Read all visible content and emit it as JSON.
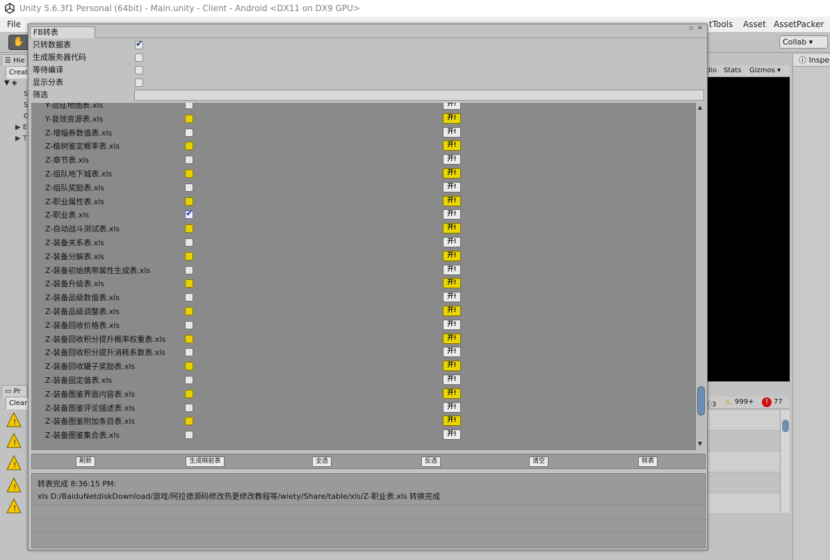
{
  "titlebar": {
    "title": "Unity 5.6.3f1 Personal (64bit) - Main.unity - Client - Android <DX11 on DX9 GPU>"
  },
  "menubar": {
    "items": [
      "File",
      "tTools",
      "Asset",
      "AssetPacker"
    ]
  },
  "toolbar": {
    "collab_label": "Collab ▾"
  },
  "hierarchy": {
    "tab": "☰ Hie",
    "create": "Creat",
    "rows": [
      "S",
      "S",
      "G",
      "E",
      "T"
    ]
  },
  "gameview": {
    "tabs": [
      "dio",
      "Stats",
      "Gizmos ▾"
    ]
  },
  "project": {
    "tab": "Pr",
    "clear": "Clear"
  },
  "console": {
    "count_info": "3",
    "count_warn": "999+",
    "count_err": "77"
  },
  "inspector": {
    "tab": "Inspe"
  },
  "window": {
    "tab": "FB转表",
    "options": [
      {
        "label": "只转数据表",
        "checked": true
      },
      {
        "label": "生成服务器代码",
        "checked": false
      },
      {
        "label": "等待编译",
        "checked": false
      },
      {
        "label": "显示分表",
        "checked": false
      }
    ],
    "filter_label": "筛选",
    "filter_value": "",
    "open_label": "开!",
    "files": [
      {
        "name": "Y-远征地图表.xls",
        "state": "off"
      },
      {
        "name": "Y-音效资源表.xls",
        "state": "yellow"
      },
      {
        "name": "Z-增幅券数值表.xls",
        "state": "off"
      },
      {
        "name": "Z-植树鉴定概率表.xls",
        "state": "yellow"
      },
      {
        "name": "Z-章节表.xls",
        "state": "off"
      },
      {
        "name": "Z-组队地下城表.xls",
        "state": "yellow"
      },
      {
        "name": "Z-组队奖励表.xls",
        "state": "off"
      },
      {
        "name": "Z-职业属性表.xls",
        "state": "yellow"
      },
      {
        "name": "Z-职业表.xls",
        "state": "on"
      },
      {
        "name": "Z-自动战斗测试表.xls",
        "state": "yellow"
      },
      {
        "name": "Z-装备关系表.xls",
        "state": "off"
      },
      {
        "name": "Z-装备分解表.xls",
        "state": "yellow"
      },
      {
        "name": "Z-装备初始携带属性生成表.xls",
        "state": "off"
      },
      {
        "name": "Z-装备升级表.xls",
        "state": "yellow"
      },
      {
        "name": "Z-装备品级数值表.xls",
        "state": "off"
      },
      {
        "name": "Z-装备品级调整表.xls",
        "state": "yellow"
      },
      {
        "name": "Z-装备回收价格表.xls",
        "state": "off"
      },
      {
        "name": "Z-装备回收积分提升概率权重表.xls",
        "state": "yellow"
      },
      {
        "name": "Z-装备回收积分提升消耗系数表.xls",
        "state": "off"
      },
      {
        "name": "Z-装备回收罐子奖励表.xls",
        "state": "yellow"
      },
      {
        "name": "Z-装备固定值表.xls",
        "state": "off"
      },
      {
        "name": "Z-装备图鉴界面内容表.xls",
        "state": "yellow"
      },
      {
        "name": "Z-装备图鉴评论描述表.xls",
        "state": "off"
      },
      {
        "name": "Z-装备图鉴附加条目表.xls",
        "state": "yellow"
      },
      {
        "name": "Z-装备图鉴集合表.xls",
        "state": "off"
      }
    ],
    "actions": [
      "刷新",
      "生成映射表",
      "全选",
      "反选",
      "清空",
      "转表"
    ],
    "log": [
      "转表完成 8:36:15 PM:",
      "xls D:/BaiduNetdiskDownload/游戏/阿拉德源码修改热更修改教程等/wiety/Share/table/xls/Z-职业表.xls 转换完成"
    ]
  }
}
